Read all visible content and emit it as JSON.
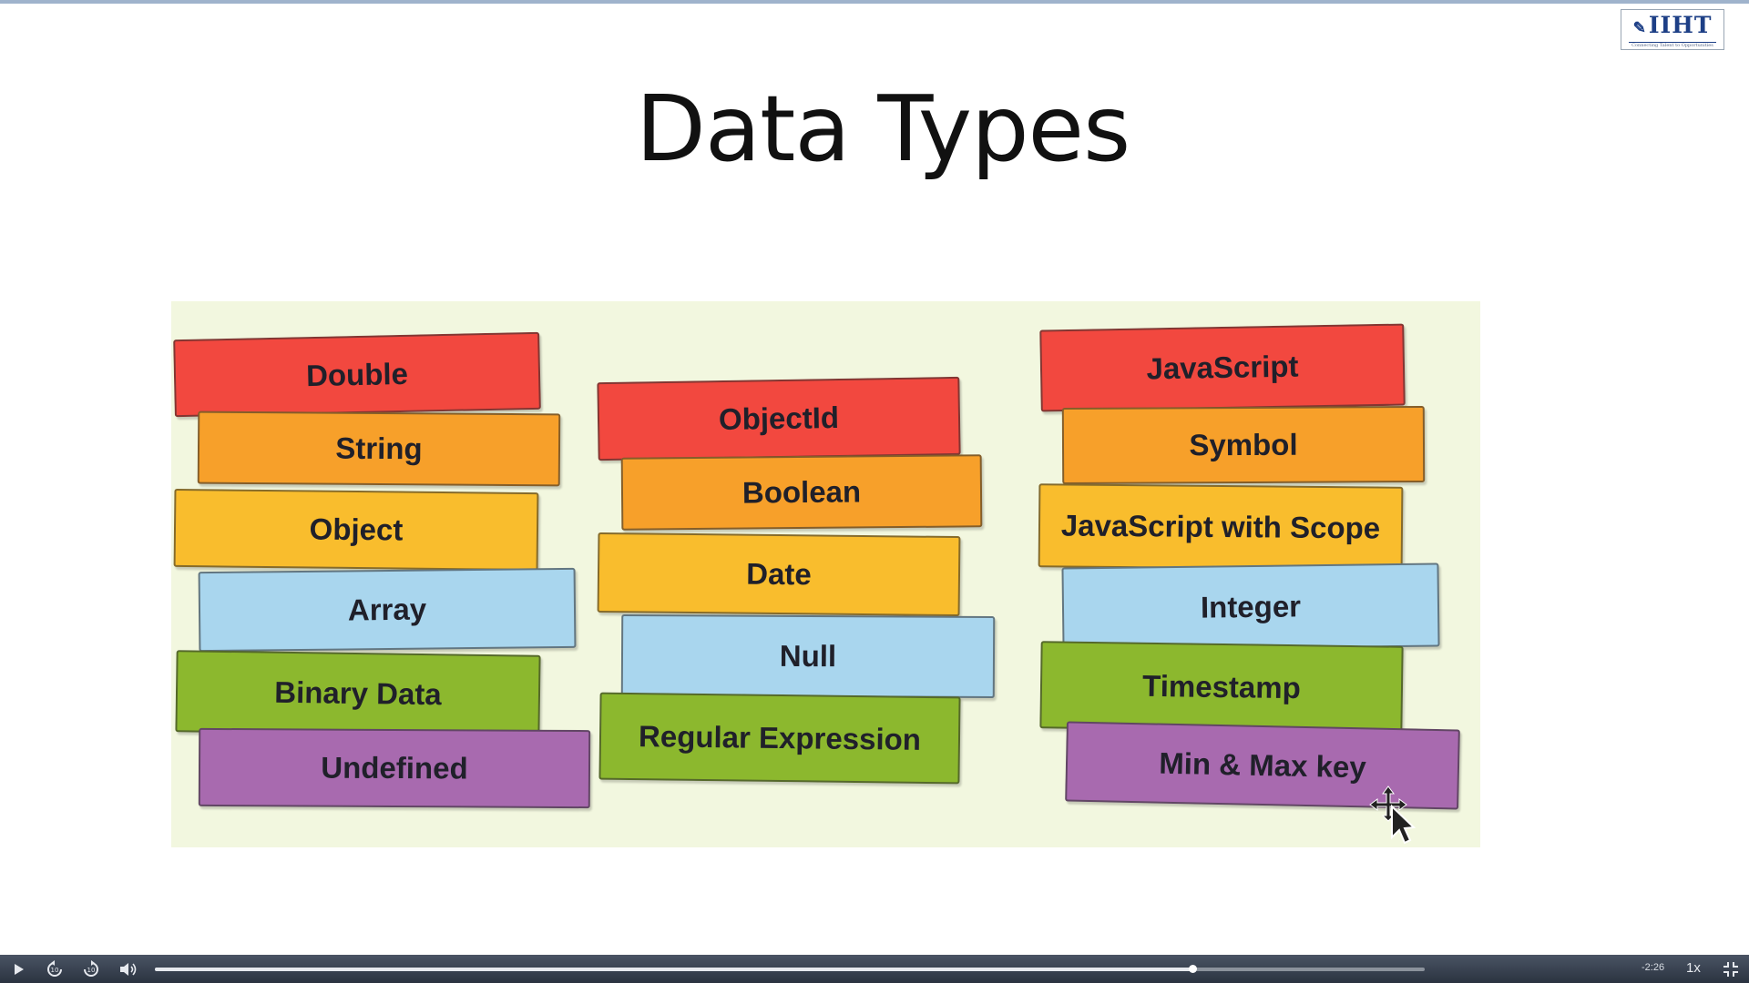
{
  "slide": {
    "title": "Data Types",
    "logo": {
      "brand": "IIHT",
      "tagline": "Connecting Talent to Opportunities"
    },
    "columns": [
      {
        "items": [
          {
            "label": "Double",
            "color": "#f2483f"
          },
          {
            "label": "String",
            "color": "#f7a02a"
          },
          {
            "label": "Object",
            "color": "#f9bd2d"
          },
          {
            "label": "Array",
            "color": "#a9d6ee"
          },
          {
            "label": "Binary Data",
            "color": "#8cb82e"
          },
          {
            "label": "Undefined",
            "color": "#a86aaf"
          }
        ]
      },
      {
        "items": [
          {
            "label": "ObjectId",
            "color": "#f2483f"
          },
          {
            "label": "Boolean",
            "color": "#f7a02a"
          },
          {
            "label": "Date",
            "color": "#f9bd2d"
          },
          {
            "label": "Null",
            "color": "#a9d6ee"
          },
          {
            "label": "Regular Expression",
            "color": "#8cb82e"
          }
        ]
      },
      {
        "items": [
          {
            "label": "JavaScript",
            "color": "#f2483f"
          },
          {
            "label": "Symbol",
            "color": "#f7a02a"
          },
          {
            "label": "JavaScript with Scope",
            "color": "#f9bd2d"
          },
          {
            "label": "Integer",
            "color": "#a9d6ee"
          },
          {
            "label": "Timestamp",
            "color": "#8cb82e"
          },
          {
            "label": "Min & Max key",
            "color": "#a86aaf"
          }
        ]
      }
    ]
  },
  "player": {
    "time_remaining": "-2:26",
    "speed": "1x",
    "progress": 0.817,
    "icons": {
      "play": "play-icon",
      "rewind": "rewind-icon",
      "forward": "forward-icon",
      "volume": "volume-icon",
      "fullscreen": "fullscreen-icon"
    }
  }
}
